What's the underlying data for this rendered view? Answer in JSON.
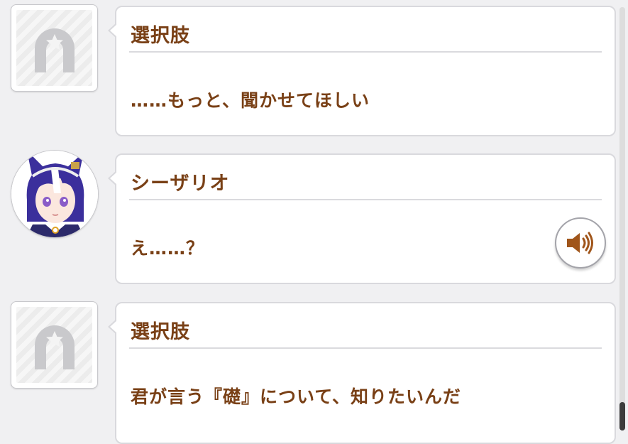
{
  "log": [
    {
      "type": "choice",
      "speaker": "選択肢",
      "text": "……もっと、聞かせてほしい",
      "icon": "horseshoe-placeholder-icon"
    },
    {
      "type": "character",
      "speaker": "シーザリオ",
      "text": "え……？",
      "icon": "character-portrait",
      "voice": "speaker-voice-icon"
    },
    {
      "type": "choice",
      "speaker": "選択肢",
      "text": "君が言う『礎』について、知りたいんだ",
      "icon": "horseshoe-placeholder-icon"
    }
  ],
  "colors": {
    "text_brown": "#794016",
    "bubble_border": "#d9d9dd",
    "background": "#f0f0f2",
    "hair_blue": "#3b2f9c",
    "speaker_brown": "#a0551a"
  }
}
